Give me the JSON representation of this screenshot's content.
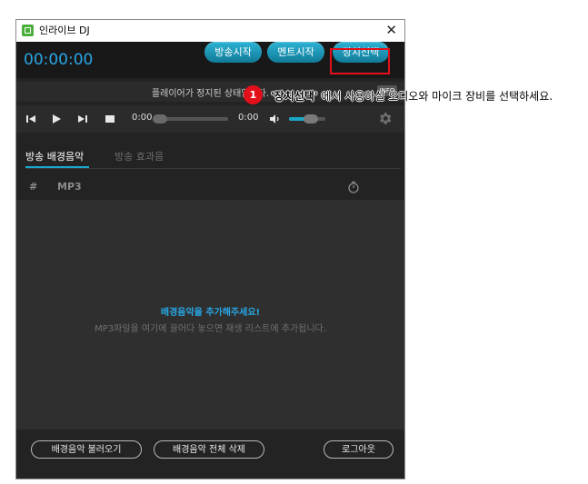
{
  "window": {
    "title": "인라이브 DJ"
  },
  "topbar": {
    "timer": "00:00:00",
    "buttons": {
      "broadcast_start": "방송시작",
      "ment_start": "멘트시작",
      "device_select": "장치선택"
    }
  },
  "status": {
    "message": "플레이어가 정지된 상태입니다.",
    "badge": "INFO"
  },
  "player": {
    "elapsed": "0:00",
    "duration": "0:00",
    "progress": 0,
    "volume": 0.5
  },
  "tabs": [
    {
      "label": "방송 배경음악",
      "active": true
    },
    {
      "label": "방송 효과음",
      "active": false
    }
  ],
  "list": {
    "columns": {
      "index": "#",
      "title": "MP3"
    },
    "empty_title": "배경음악을 추가해주세요!",
    "empty_subtitle": "MP3파일을 여기에 끌어다 놓으면 재생 리스트에 추가됩니다."
  },
  "footer": {
    "load_button": "배경음악 불러오기",
    "clear_button": "배경음악 전체 삭제",
    "logout_button": "로그아웃"
  },
  "annotation": {
    "step": "1",
    "highlight": "'장치선택'",
    "text": " 에서 사용하실 오디오와 마이크 장비를 선택하세요."
  },
  "colors": {
    "accent": "#29a6e5",
    "button": "#1a98bd",
    "highlight": "#e3101a"
  }
}
